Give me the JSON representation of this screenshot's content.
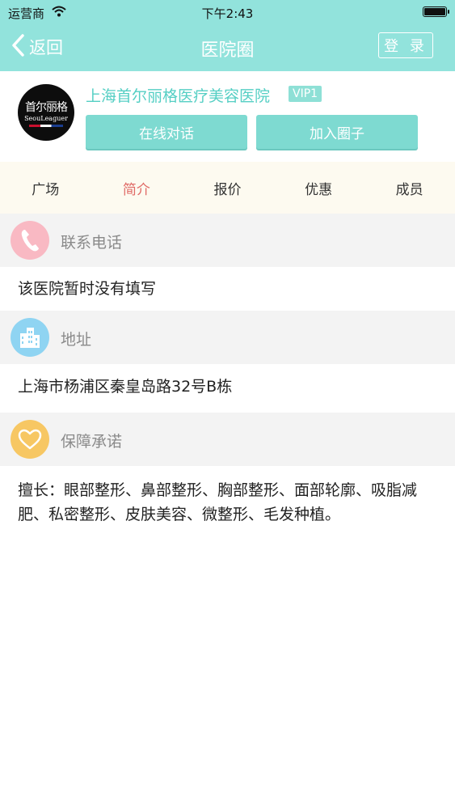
{
  "status_bar": {
    "carrier": "运营商",
    "time": "下午2:43"
  },
  "navbar": {
    "back_label": "返回",
    "title": "医院圈",
    "login_label": "登 录"
  },
  "hospital": {
    "logo_text_cn": "首尔丽格",
    "logo_text_en": "SeouLeaguer",
    "name": "上海首尔丽格医疗美容医院",
    "badge": "VIP1",
    "chat_button": "在线对话",
    "join_button": "加入圈子"
  },
  "tabs": [
    {
      "label": "广场"
    },
    {
      "label": "简介"
    },
    {
      "label": "报价"
    },
    {
      "label": "优惠"
    },
    {
      "label": "成员"
    }
  ],
  "active_tab": "简介",
  "sections": {
    "phone": {
      "title": "联系电话",
      "content": "该医院暂时没有填写",
      "icon": "phone-icon",
      "icon_color": "#f9b9c3"
    },
    "address": {
      "title": "地址",
      "content": "上海市杨浦区秦皇岛路32号B栋",
      "icon": "building-icon",
      "icon_color": "#8fd4f2"
    },
    "guarantee": {
      "title": "保障承诺",
      "content": "擅长：眼部整形、鼻部整形、胸部整形、面部轮廓、吸脂减肥、私密整形、皮肤美容、微整形、毛发种植。",
      "icon": "heart-icon",
      "icon_color": "#f7c763"
    }
  },
  "colors": {
    "header": "#92e3dc",
    "accent": "#55cfc4",
    "button": "#7edad1",
    "active_tab": "#e06a66",
    "tab_bar_bg": "#fdfaf0"
  }
}
